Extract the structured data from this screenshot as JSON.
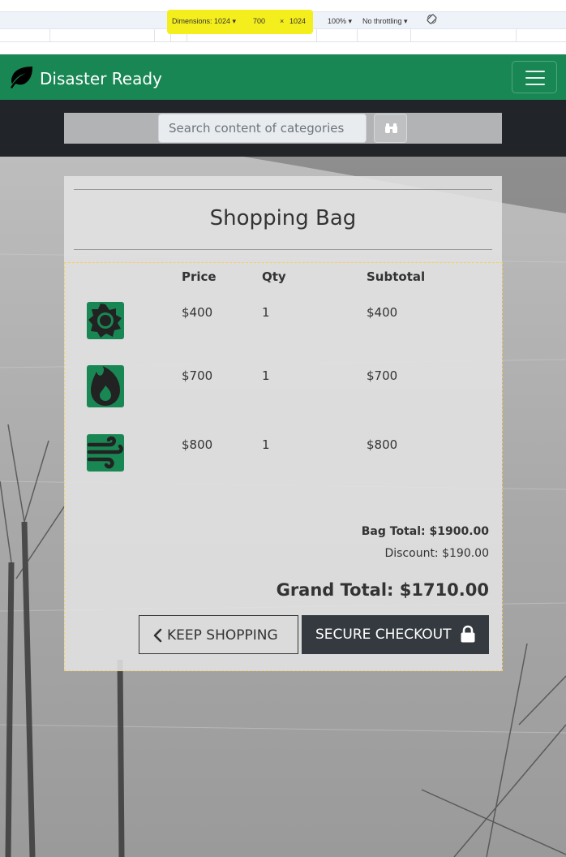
{
  "devtools": {
    "dimensions_label": "Dimensions: 1024 ▾",
    "width": "700",
    "times": "×",
    "height": "1024",
    "zoom": "100% ▾",
    "throttling": "No throttling ▾",
    "rotate_icon": "rotate-icon"
  },
  "navbar": {
    "brand_name": "Disaster Ready",
    "brand_icon": "leaf-icon",
    "toggler_icon": "hamburger-icon",
    "background_color": "#198754"
  },
  "search": {
    "placeholder": "Search content of categories",
    "button_icon": "binoculars-icon"
  },
  "bag": {
    "title": "Shopping Bag",
    "columns": [
      "Price",
      "Qty",
      "Subtotal"
    ],
    "items": [
      {
        "icon": "sun-icon",
        "price": "$400",
        "qty": "1",
        "subtotal": "$400"
      },
      {
        "icon": "fire-icon",
        "price": "$700",
        "qty": "1",
        "subtotal": "$700"
      },
      {
        "icon": "wind-icon",
        "price": "$800",
        "qty": "1",
        "subtotal": "$800"
      }
    ],
    "bag_total": "Bag Total: $1900.00",
    "discount": "Discount: $190.00",
    "grand_total": "Grand Total: $1710.00",
    "keep_shopping": "KEEP SHOPPING",
    "keep_shopping_icon": "chevron-left-icon",
    "secure_checkout": "SECURE CHECKOUT",
    "secure_checkout_icon": "lock-icon"
  },
  "colors": {
    "accent": "#198754",
    "dark": "#212529",
    "button_dark": "#343a40",
    "devtools_highlight": "#f4ee1c"
  }
}
